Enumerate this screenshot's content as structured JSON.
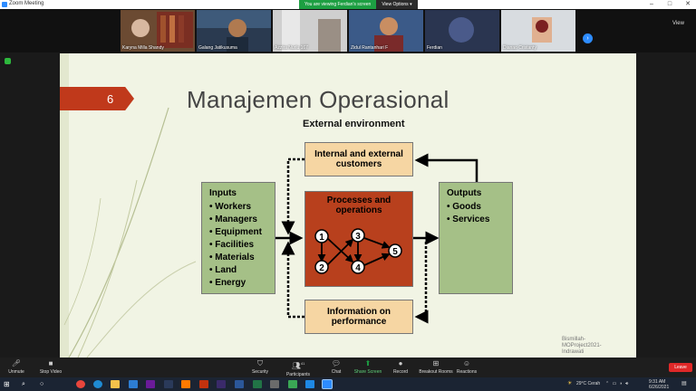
{
  "window": {
    "title": "Zoom Meeting",
    "minimize": "–",
    "maximize": "□",
    "close": "✕"
  },
  "share_bar": {
    "message": "You are viewing Ferdian's screen",
    "options": "View Options ▾"
  },
  "participants": [
    {
      "name": "Karyna Milla Shandy"
    },
    {
      "name": "Galang Jatikusuma"
    },
    {
      "name": "Azzira Nurlu 167"
    },
    {
      "name": "Zidul Rantanhari F"
    },
    {
      "name": "Ferdian"
    },
    {
      "name": "Dianao Cristanty"
    }
  ],
  "view_button": "View",
  "slide": {
    "number": "6",
    "title": "Manajemen Operasional",
    "external_environment": "External environment",
    "customers_box": "Internal and external customers",
    "performance_box": "Information on performance",
    "process_box": "Processes and operations",
    "inputs": {
      "heading": "Inputs",
      "items": [
        "• Workers",
        "• Managers",
        "• Equipment",
        "• Facilities",
        "• Materials",
        "• Land",
        "• Energy"
      ]
    },
    "outputs": {
      "heading": "Outputs",
      "items": [
        "• Goods",
        "• Services"
      ]
    },
    "nodes": [
      "1",
      "2",
      "3",
      "4",
      "5"
    ],
    "credit": "Bismillah- MOProject2021- Indrawati"
  },
  "toolbar": {
    "unmute": "Unmute",
    "stop_video": "Stop Video",
    "security": "Security",
    "participants": "Participants",
    "participants_count": "41",
    "chat": "Chat",
    "share_screen": "Share Screen",
    "record": "Record",
    "breakout": "Breakout Rooms",
    "reactions": "Reactions",
    "leave": "Leave"
  },
  "taskbar": {
    "weather": "29°C Cerah",
    "time": "9:31 AM",
    "date": "6/26/2021"
  },
  "colors": {
    "accent": "#2d8cff",
    "banner": "#c0391b",
    "process": "#b8401d",
    "tan": "#f6d6a3",
    "green": "#a5c087"
  }
}
